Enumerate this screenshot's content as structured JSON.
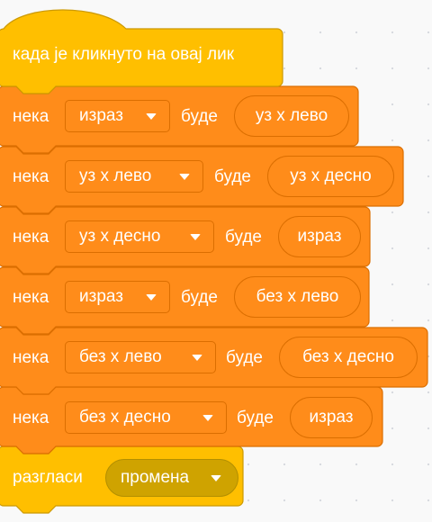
{
  "script": {
    "hat": {
      "label": "када је кликнуто на овај лик"
    },
    "set_blocks": [
      {
        "keyword": "нека",
        "variable": "израз",
        "to": "буде",
        "value": "уз x лево"
      },
      {
        "keyword": "нека",
        "variable": "уз x лево",
        "to": "буде",
        "value": "уз x десно"
      },
      {
        "keyword": "нека",
        "variable": "уз x десно",
        "to": "буде",
        "value": "израз"
      },
      {
        "keyword": "нека",
        "variable": "израз",
        "to": "буде",
        "value": "без x лево"
      },
      {
        "keyword": "нека",
        "variable": "без x лево",
        "to": "буде",
        "value": "без x десно"
      },
      {
        "keyword": "нека",
        "variable": "без x десно",
        "to": "буде",
        "value": "израз"
      }
    ],
    "broadcast": {
      "label": "разгласи",
      "message": "промена"
    }
  },
  "colors": {
    "variables_block": "#ff8c1a",
    "variables_border": "#db6e00",
    "events_block": "#ffbf00",
    "events_border": "#cc9900",
    "events_input": "#cfa300",
    "canvas_background": "#f9f9f9"
  },
  "icons": {
    "dropdown": "caret-down-icon"
  }
}
